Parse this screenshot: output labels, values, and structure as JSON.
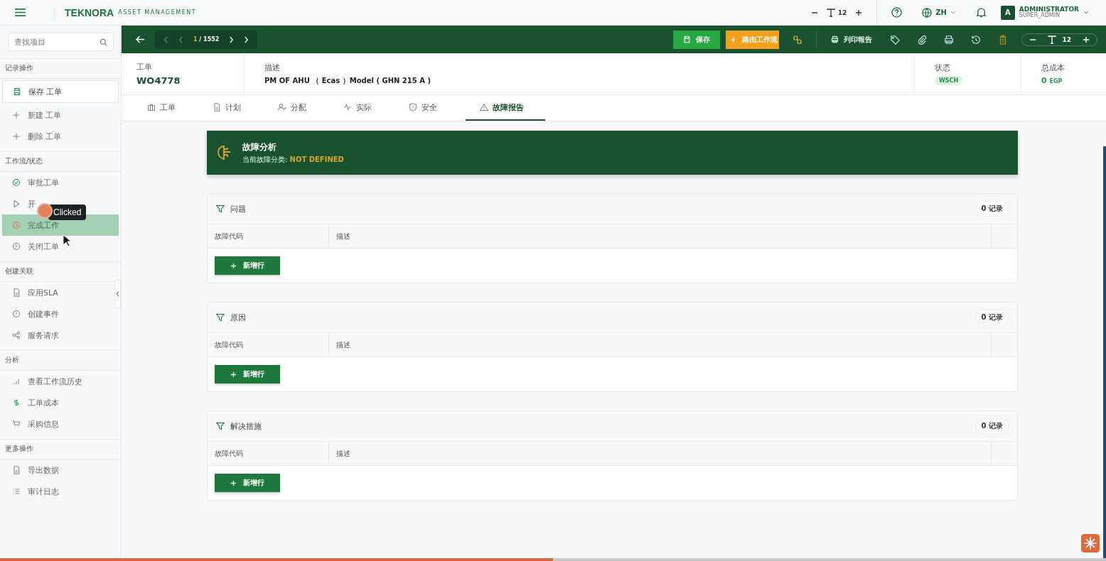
{
  "topbar": {
    "logo": "TEKNORA",
    "logo_subtitle": "ASSET MANAGEMENT",
    "font_size": "12",
    "language": "ZH",
    "user": {
      "avatar": "A",
      "name": "ADMINISTRATOR",
      "role": "SUPER_ADMIN"
    }
  },
  "sidebar": {
    "search": {
      "placeholder": "查找项目"
    },
    "sections": [
      {
        "title": "记录操作",
        "items": [
          {
            "label": "保存 工单",
            "kind": "card",
            "selected": false
          },
          {
            "label": "新建 工单",
            "kind": "plain",
            "selected": false
          },
          {
            "label": "删除 工单",
            "kind": "plain",
            "selected": false
          }
        ]
      },
      {
        "title": "工作流/状态",
        "items": [
          {
            "label": "审批工单",
            "kind": "plain",
            "selected": false
          },
          {
            "label": "开",
            "kind": "plain",
            "selected": false
          },
          {
            "label": "完成工作",
            "kind": "plain",
            "selected": true
          },
          {
            "label": "关闭工单",
            "kind": "plain",
            "selected": false
          }
        ]
      },
      {
        "title": "创建关联",
        "items": [
          {
            "label": "应用SLA",
            "kind": "plain",
            "selected": false
          },
          {
            "label": "创建事件",
            "kind": "plain",
            "selected": false
          },
          {
            "label": "服务请求",
            "kind": "plain",
            "selected": false
          }
        ]
      },
      {
        "title": "分析",
        "items": [
          {
            "label": "查看工作流历史",
            "kind": "plain",
            "selected": false
          },
          {
            "label": "工单成本",
            "kind": "plain",
            "selected": false
          },
          {
            "label": "采购信息",
            "kind": "plain",
            "selected": false
          }
        ]
      },
      {
        "title": "更多操作",
        "items": [
          {
            "label": "导出数据",
            "kind": "plain",
            "selected": false
          },
          {
            "label": "审计日志",
            "kind": "plain",
            "selected": false
          }
        ]
      }
    ]
  },
  "tooltip": "Clicked",
  "toolbar": {
    "pager": {
      "current": "1",
      "total": "/ 1552"
    },
    "save": "保存",
    "route": "路由工作流",
    "print_report": "列印報告",
    "font_size": "12"
  },
  "header": {
    "fields": [
      {
        "label": "工单",
        "value": "WO4778",
        "kind": "id"
      },
      {
        "label": "描述",
        "value": "PM OF AHU （ Ecas ）Model ( GHN 215 A )",
        "kind": "text"
      },
      {
        "label": "状态",
        "value": "WSCH",
        "kind": "status"
      },
      {
        "label": "总成本",
        "value": "0",
        "unit": "EGP",
        "kind": "cost"
      }
    ]
  },
  "tabs": [
    {
      "label": "工单",
      "selected": false
    },
    {
      "label": "计划",
      "selected": false
    },
    {
      "label": "分配",
      "selected": false
    },
    {
      "label": "实际",
      "selected": false
    },
    {
      "label": "安全",
      "selected": false
    },
    {
      "label": "故障报告",
      "selected": true
    }
  ],
  "banner": {
    "title": "故障分析",
    "subtitle": "当前故障分类:",
    "value": "NOT DEFINED"
  },
  "sections": [
    {
      "title": "问题",
      "count": "0 记录",
      "columns": [
        "故障代码",
        "描述"
      ],
      "add_button": "新增行"
    },
    {
      "title": "原因",
      "count": "0 记录",
      "columns": [
        "故障代码",
        "描述"
      ],
      "add_button": "新增行"
    },
    {
      "title": "解决措施",
      "count": "0 记录",
      "columns": [
        "故障代码",
        "描述"
      ],
      "add_button": "新增行"
    }
  ],
  "playback_bar": {
    "level": 0.5
  }
}
